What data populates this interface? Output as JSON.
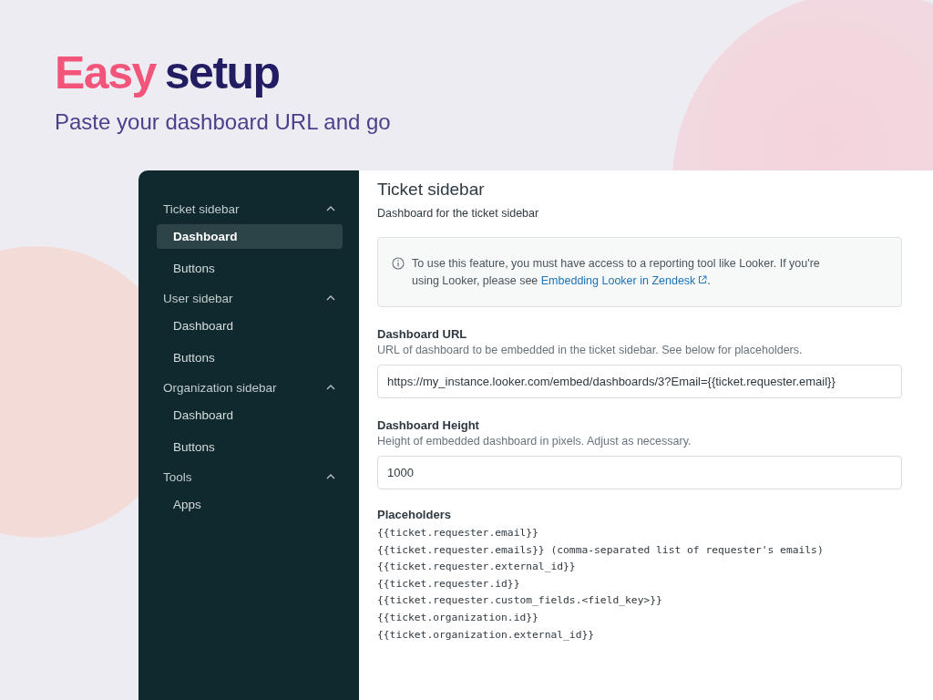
{
  "hero": {
    "title_highlight": "Easy",
    "title_rest": "setup",
    "subtitle": "Paste your dashboard URL and go"
  },
  "sidebar": {
    "groups": [
      {
        "label": "Ticket sidebar",
        "expanded": true,
        "items": [
          {
            "label": "Dashboard",
            "selected": true
          },
          {
            "label": "Buttons",
            "selected": false
          }
        ]
      },
      {
        "label": "User sidebar",
        "expanded": true,
        "items": [
          {
            "label": "Dashboard",
            "selected": false
          },
          {
            "label": "Buttons",
            "selected": false
          }
        ]
      },
      {
        "label": "Organization sidebar",
        "expanded": true,
        "items": [
          {
            "label": "Dashboard",
            "selected": false
          },
          {
            "label": "Buttons",
            "selected": false
          }
        ]
      },
      {
        "label": "Tools",
        "expanded": true,
        "items": [
          {
            "label": "Apps",
            "selected": false
          }
        ]
      }
    ]
  },
  "content": {
    "title": "Ticket sidebar",
    "description": "Dashboard for the ticket sidebar",
    "notice": {
      "text": "To use this feature, you must have access to a reporting tool like Looker. If you're using Looker, please see ",
      "link": "Embedding Looker in Zendesk",
      "after": "."
    },
    "fields": [
      {
        "label": "Dashboard URL",
        "hint": "URL of dashboard to be embedded in the ticket sidebar. See below for placeholders.",
        "value": "https://my_instance.looker.com/embed/dashboards/3?Email={{ticket.requester.email}}"
      },
      {
        "label": "Dashboard Height",
        "hint": "Height of embedded dashboard in pixels. Adjust as necessary.",
        "value": "1000"
      }
    ],
    "placeholders": {
      "label": "Placeholders",
      "lines": [
        "{{ticket.requester.email}}",
        "{{ticket.requester.emails}} (comma-separated list of requester's emails)",
        "{{ticket.requester.external_id}}",
        "{{ticket.requester.id}}",
        "{{ticket.requester.custom_fields.<field_key>}}",
        "{{ticket.organization.id}}",
        "{{ticket.organization.external_id}}"
      ]
    }
  }
}
